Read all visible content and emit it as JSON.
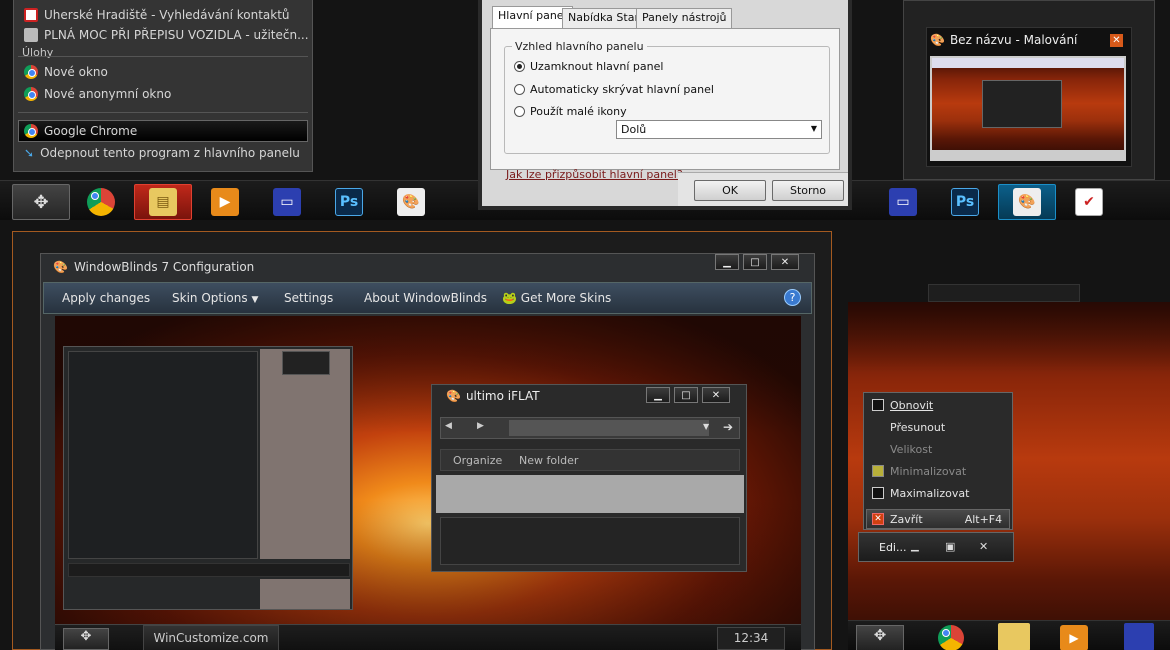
{
  "jumplist": {
    "recent": [
      "Uherské Hradiště - Vyhledávání kontaktů",
      "PLNÁ MOC PŘI PŘEPISU VOZIDLA - užitečn..."
    ],
    "tasks_header": "Úlohy",
    "tasks": [
      "Nové okno",
      "Nové anonymní okno"
    ],
    "app": "Google Chrome",
    "unpin": "Odepnout tento program z hlavního panelu"
  },
  "taskdlg": {
    "tabs": [
      "Hlavní panel",
      "Nabídka Start",
      "Panely nástrojů"
    ],
    "group": "Vzhled hlavního panelu",
    "options": [
      "Uzamknout hlavní panel",
      "Automaticky skrývat hlavní panel",
      "Použít malé ikony"
    ],
    "position_value": "Dolů",
    "help_link": "Jak lze přizpůsobit hlavní panel?",
    "ok": "OK",
    "cancel": "Storno"
  },
  "paint_thumb": {
    "title": "Bez názvu - Malování"
  },
  "wb": {
    "title": "WindowBlinds 7 Configuration",
    "menu": [
      "Apply changes",
      "Skin Options",
      "Settings",
      "About WindowBlinds",
      "Get More Skins"
    ],
    "help": "?"
  },
  "ultimo": {
    "title": "ultimo iFLAT",
    "organize": "Organize",
    "new_folder": "New folder"
  },
  "inner_taskbar": {
    "label": "WinCustomize.com",
    "clock": "12:34"
  },
  "context": {
    "items": [
      "Obnovit",
      "Přesunout",
      "Velikost",
      "Minimalizovat",
      "Maximalizovat",
      "Zavřít"
    ],
    "shortcut": "Alt+F4",
    "thumb_title": "Edi..."
  },
  "icons": [
    "start-icon",
    "chrome-icon",
    "explorer-icon",
    "media-player-icon",
    "save-icon",
    "photoshop-icon",
    "paint-icon",
    "tasks-icon"
  ],
  "colors": {
    "accent": "#c0281a",
    "highlight": "#1b8fc8",
    "link": "#7a1a1a"
  }
}
